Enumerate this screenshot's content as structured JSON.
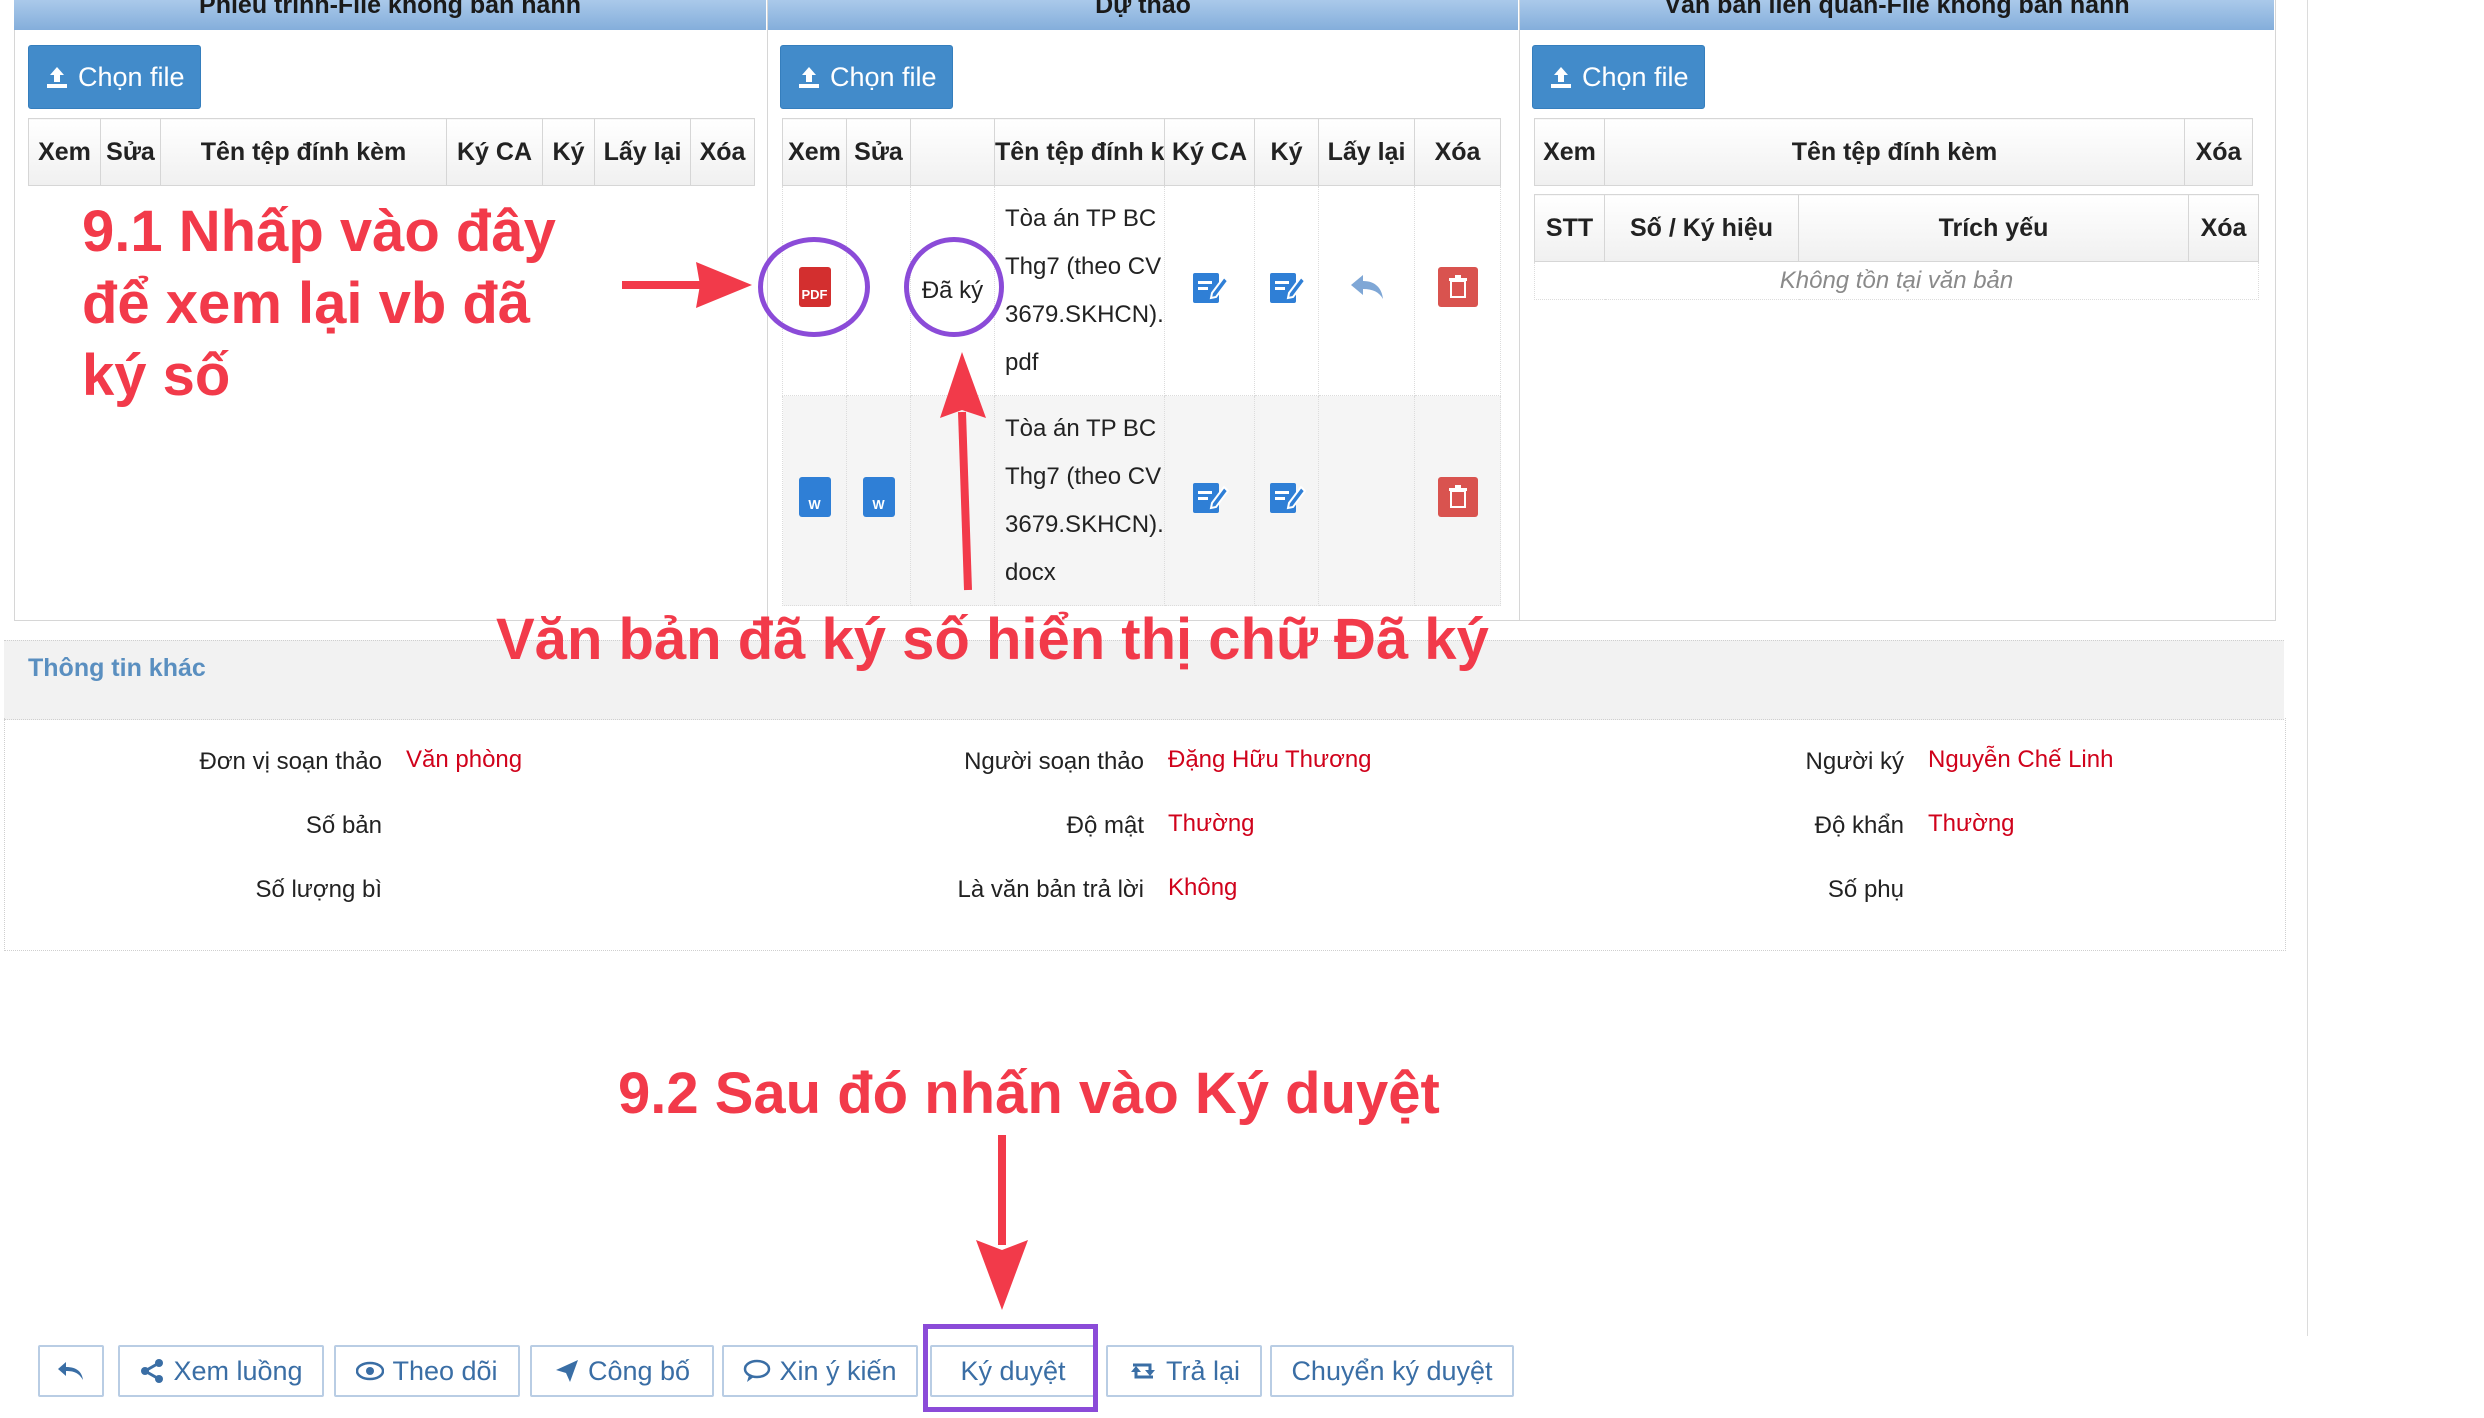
{
  "panels": {
    "left": {
      "header": "Phiếu trình-File không ban hành",
      "choose_label": "Chọn file",
      "headers": [
        "Xem",
        "Sửa",
        "Tên tệp đính kèm",
        "Ký CA",
        "Ký",
        "Lấy lại",
        "Xóa"
      ]
    },
    "middle": {
      "header": "Dự thảo",
      "choose_label": "Chọn file",
      "headers": [
        "Xem",
        "Sửa",
        "",
        "Tên tệp đính kèm",
        "Ký CA",
        "Ký",
        "Lấy lại",
        "Xóa"
      ],
      "rows": [
        {
          "name_lines": [
            "Tòa án TP BC",
            "Thg7 (theo CV",
            "3679.SKHCN).",
            "pdf"
          ],
          "status": "Đã ký",
          "view_icon": "pdf-icon"
        },
        {
          "name_lines": [
            "Tòa án TP BC",
            "Thg7 (theo CV",
            "3679.SKHCN).",
            "docx"
          ],
          "status": "",
          "view_icon": "word-icon"
        }
      ]
    },
    "right": {
      "header": "Văn bản liên quan-File không ban hành",
      "choose_label": "Chọn file",
      "headers": [
        "Xem",
        "Tên tệp đính kèm",
        "Xóa"
      ],
      "sub_headers": [
        "STT",
        "Số / Ký hiệu",
        "Trích yếu",
        "Xóa"
      ],
      "empty_text": "Không tồn tại văn bản"
    }
  },
  "info": {
    "title": "Thông tin khác",
    "fields": [
      {
        "label": "Đơn vị soạn thảo",
        "value": "Văn phòng"
      },
      {
        "label": "Người soạn thảo",
        "value": "Đặng Hữu Thương"
      },
      {
        "label": "Người ký",
        "value": "Nguyễn Chế Linh"
      },
      {
        "label": "Số bản",
        "value": ""
      },
      {
        "label": "Độ mật",
        "value": "Thường"
      },
      {
        "label": "Độ khẩn",
        "value": "Thường"
      },
      {
        "label": "Số lượng bì",
        "value": ""
      },
      {
        "label": "Là văn bản trả lời",
        "value": "Không"
      },
      {
        "label": "Số phụ",
        "value": ""
      }
    ]
  },
  "annotations": {
    "step1_lines": [
      "9.1 Nhấp vào đây",
      "để xem lại vb đã",
      "ký số"
    ],
    "signed_note": "Văn bản đã ký số hiển thị chữ Đã ký",
    "step2": "9.2 Sau đó nhấn vào Ký duyệt"
  },
  "toolbar": {
    "back_icon": "back-arrow-icon",
    "buttons": [
      "Xem luồng",
      "Theo dõi",
      "Công bố",
      "Xin ý kiến",
      "Ký duyệt",
      "Trả lại",
      "Chuyển ký duyệt"
    ]
  },
  "colors": {
    "primary_button": "#428bca",
    "annotation": "#f23a4a",
    "highlight": "#8b4bd8",
    "value_text": "#d0021b"
  }
}
